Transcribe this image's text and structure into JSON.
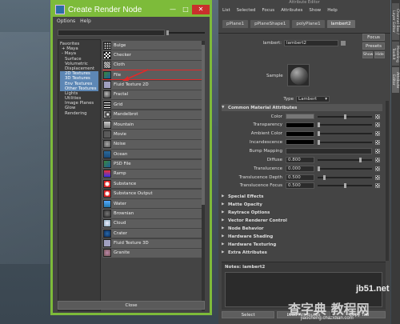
{
  "render_node": {
    "title": "Create Render Node",
    "menu": [
      "Options",
      "Help"
    ],
    "tree": [
      {
        "label": "Favorites",
        "selected": false
      },
      {
        "label": "+ Maya",
        "selected": false
      },
      {
        "label": "- Maya",
        "selected": false
      },
      {
        "label": "Surface",
        "selected": false
      },
      {
        "label": "Volumetric",
        "selected": false
      },
      {
        "label": "Displacement",
        "selected": false
      },
      {
        "label": "2D Textures",
        "selected": true
      },
      {
        "label": "3D Textures",
        "selected": true
      },
      {
        "label": "Env Textures",
        "selected": true
      },
      {
        "label": "Other Textures",
        "selected": true
      },
      {
        "label": "Lights",
        "selected": false
      },
      {
        "label": "Utilities",
        "selected": false
      },
      {
        "label": "Image Planes",
        "selected": false
      },
      {
        "label": "Glow",
        "selected": false
      },
      {
        "label": "Rendering",
        "selected": false
      }
    ],
    "nodes": [
      {
        "label": "Bulge",
        "icon": "bulge"
      },
      {
        "label": "Checker",
        "icon": "checker"
      },
      {
        "label": "Cloth",
        "icon": "cloth"
      },
      {
        "label": "File",
        "icon": "file"
      },
      {
        "label": "Fluid Texture 2D",
        "icon": "fluid"
      },
      {
        "label": "Fractal",
        "icon": "fractal"
      },
      {
        "label": "Grid",
        "icon": "grid"
      },
      {
        "label": "Mandelbrot",
        "icon": "mandel"
      },
      {
        "label": "Mountain",
        "icon": "mountain"
      },
      {
        "label": "Movie",
        "icon": "movie"
      },
      {
        "label": "Noise",
        "icon": "noise"
      },
      {
        "label": "Ocean",
        "icon": "ocean"
      },
      {
        "label": "PSD File",
        "icon": "psd"
      },
      {
        "label": "Ramp",
        "icon": "ramp"
      },
      {
        "label": "Substance",
        "icon": "sub"
      },
      {
        "label": "Substance Output",
        "icon": "sub"
      },
      {
        "label": "Water",
        "icon": "water"
      },
      {
        "label": "Brownian",
        "icon": "brownian"
      },
      {
        "label": "Cloud",
        "icon": "cloud"
      },
      {
        "label": "Crater",
        "icon": "crater"
      },
      {
        "label": "Fluid Texture 3D",
        "icon": "fluid"
      },
      {
        "label": "Granite",
        "icon": "granite"
      }
    ],
    "close_label": "Close"
  },
  "attribute_editor": {
    "window_title": "Attribute Editor",
    "menu": [
      "List",
      "Selected",
      "Focus",
      "Attributes",
      "Show",
      "Help"
    ],
    "tabs": [
      {
        "label": "pPlane1",
        "active": false
      },
      {
        "label": "pPlaneShape1",
        "active": false
      },
      {
        "label": "polyPlane1",
        "active": false
      },
      {
        "label": "lambert2",
        "active": true
      }
    ],
    "node_label": "lambert:",
    "node_name": "lambert2",
    "focus_label": "Focus",
    "presets_label": "Presets",
    "show_label": "Show",
    "hide_label": "Hide",
    "sample_label": "Sample",
    "type_label": "Type",
    "type_value": "Lambert",
    "common_section": "Common Material Attributes",
    "attrs": [
      {
        "label": "Color",
        "kind": "swatch",
        "color": "#777777",
        "level": 0.5
      },
      {
        "label": "Transparency",
        "kind": "swatch",
        "color": "#000000",
        "level": 0.0
      },
      {
        "label": "Ambient Color",
        "kind": "swatch",
        "color": "#000000",
        "level": 0.0
      },
      {
        "label": "Incandescence",
        "kind": "swatch",
        "color": "#000000",
        "level": 0.0
      },
      {
        "label": "Bump Mapping",
        "kind": "bump"
      },
      {
        "label": "Diffuse",
        "kind": "number",
        "value": "0.800",
        "level": 0.8
      },
      {
        "label": "Translucence",
        "kind": "number",
        "value": "0.000",
        "level": 0.0
      },
      {
        "label": "Translucence Depth",
        "kind": "number",
        "value": "0.500",
        "level": 0.1
      },
      {
        "label": "Translucence Focus",
        "kind": "number",
        "value": "0.500",
        "level": 0.5
      }
    ],
    "sections": [
      "Special Effects",
      "Matte Opacity",
      "Raytrace Options",
      "Vector Renderer Control",
      "Node Behavior",
      "Hardware Shading",
      "Hardware Texturing",
      "Extra Attributes"
    ],
    "notes_label": "Notes:  lambert2",
    "bottom_buttons": [
      "Select",
      "Load Attributes",
      "Copy Tab"
    ]
  },
  "side_tabs": [
    "Channel Box / Layer Editor",
    "Modeling Toolkit",
    "Attribute Editor"
  ],
  "watermark": {
    "line1": "jb51.net",
    "line2": "查字典 教程网",
    "line3": "jiaocheng.chazidian.com"
  }
}
